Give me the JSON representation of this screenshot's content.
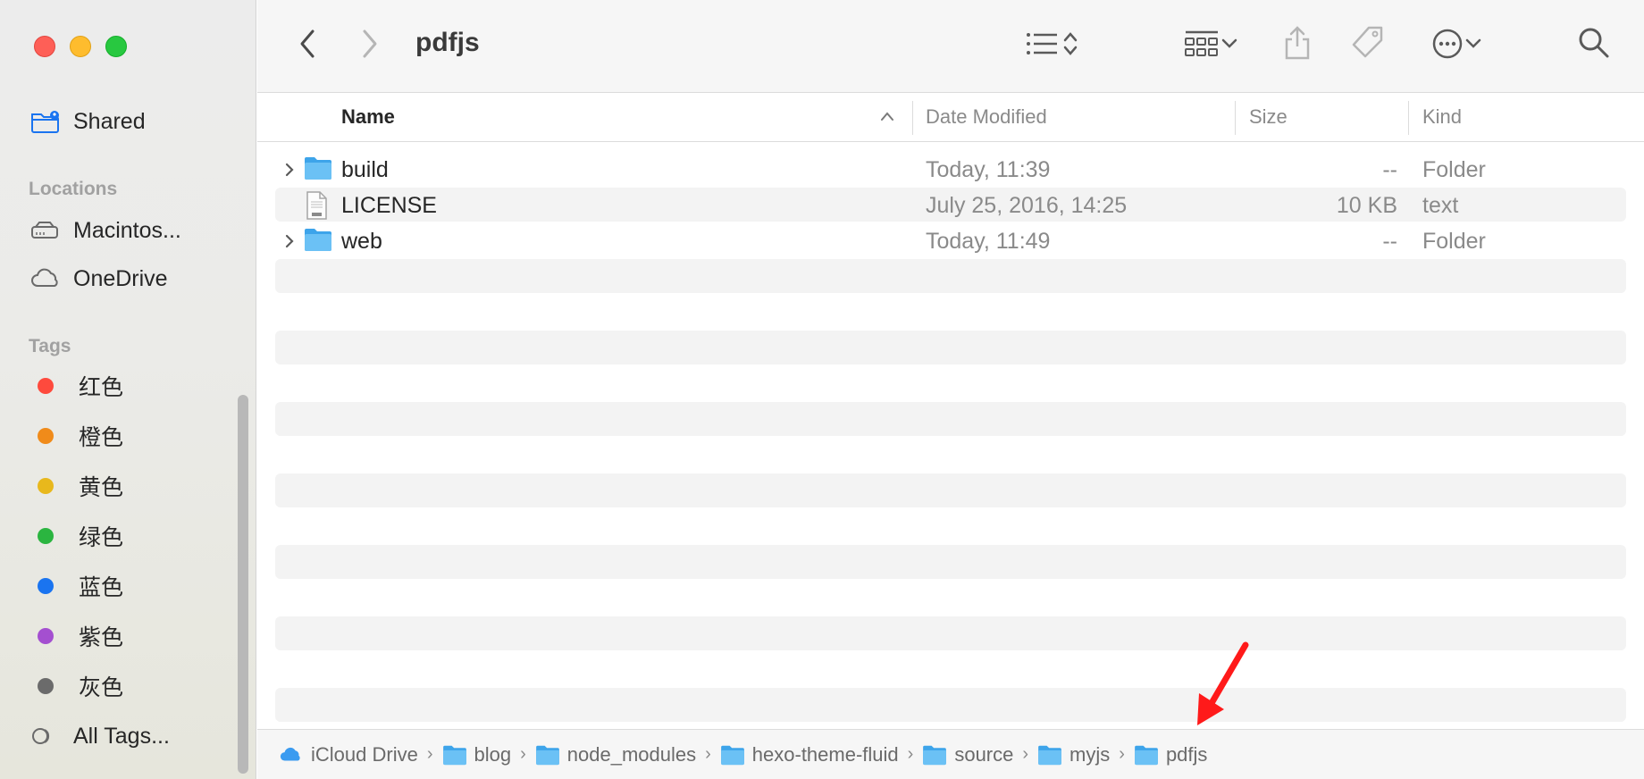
{
  "window": {
    "title": "pdfjs"
  },
  "sidebar": {
    "shared_label": "Shared",
    "locations_heading": "Locations",
    "locations": [
      {
        "label": "Macintos...",
        "icon": "hard-drive-icon"
      },
      {
        "label": "OneDrive",
        "icon": "cloud-icon"
      }
    ],
    "tags_heading": "Tags",
    "tags": [
      {
        "label": "红色",
        "color": "#fe4a3d"
      },
      {
        "label": "橙色",
        "color": "#f08b1a"
      },
      {
        "label": "黄色",
        "color": "#e8b81c"
      },
      {
        "label": "绿色",
        "color": "#2bb540"
      },
      {
        "label": "蓝色",
        "color": "#1a74f0"
      },
      {
        "label": "紫色",
        "color": "#a44fd0"
      },
      {
        "label": "灰色",
        "color": "#6b6b6b"
      }
    ],
    "all_tags_label": "All Tags..."
  },
  "columns": {
    "name": "Name",
    "date": "Date Modified",
    "size": "Size",
    "kind": "Kind"
  },
  "files": [
    {
      "name": "build",
      "date": "Today, 11:39",
      "size": "--",
      "kind": "Folder",
      "type": "folder"
    },
    {
      "name": "LICENSE",
      "date": "July 25, 2016, 14:25",
      "size": "10 KB",
      "kind": "text",
      "type": "text"
    },
    {
      "name": "web",
      "date": "Today, 11:49",
      "size": "--",
      "kind": "Folder",
      "type": "folder"
    }
  ],
  "path": [
    {
      "label": "iCloud Drive",
      "icon": "icloud-icon"
    },
    {
      "label": "blog",
      "icon": "folder-icon"
    },
    {
      "label": "node_modules",
      "icon": "folder-icon"
    },
    {
      "label": "hexo-theme-fluid",
      "icon": "folder-icon"
    },
    {
      "label": "source",
      "icon": "folder-icon"
    },
    {
      "label": "myjs",
      "icon": "folder-icon"
    },
    {
      "label": "pdfjs",
      "icon": "folder-icon"
    }
  ],
  "colors": {
    "accent": "#1a74f0",
    "folder": "#5ab5f2",
    "annotation_arrow": "#ff1a1a"
  }
}
